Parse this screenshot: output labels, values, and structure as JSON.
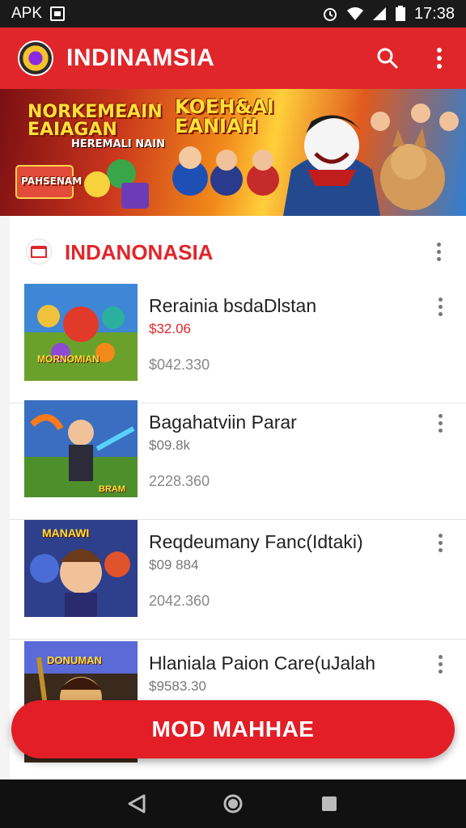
{
  "status_bar": {
    "left_text": "APK",
    "time": "17:38"
  },
  "app_bar": {
    "title": "INDINAMSIA",
    "search_icon": "search-icon",
    "menu_icon": "more-vert-icon"
  },
  "banner": {
    "left_title": "NORKEMEAIN\nEAIAGAN",
    "left_subtitle": "HEREMALI NAIN",
    "left_badge": "PAHSENAM",
    "center_title": "KOEH&AI\nEANIAH"
  },
  "section": {
    "title": "INDANONASIA",
    "icon": "store-icon"
  },
  "items": [
    {
      "title": "Rerainia bsdaDlstan",
      "price": "$32.06",
      "sub": "$042.330",
      "thumb_label": "MORNOMIAN",
      "price_style": "red"
    },
    {
      "title": "Bagahatviin Parar",
      "price": "$09.8k",
      "sub": "2228.360",
      "thumb_label": "BRAM",
      "price_style": "grey"
    },
    {
      "title": "Reqdeumany Fanc(Idtaki)",
      "price": "$09 884",
      "sub": "2042.360",
      "thumb_label": "MANAWI",
      "price_style": "grey"
    },
    {
      "title": "Hlaniala Paion Care(uJalah",
      "price": "$9583.30",
      "sub": "",
      "thumb_label": "DONUMAN",
      "price_style": "grey"
    }
  ],
  "fab": {
    "label": "MOD MAHHAE"
  },
  "colors": {
    "accent": "#e0262b",
    "fab": "#e31e26",
    "text": "#222222",
    "muted": "#888888"
  }
}
